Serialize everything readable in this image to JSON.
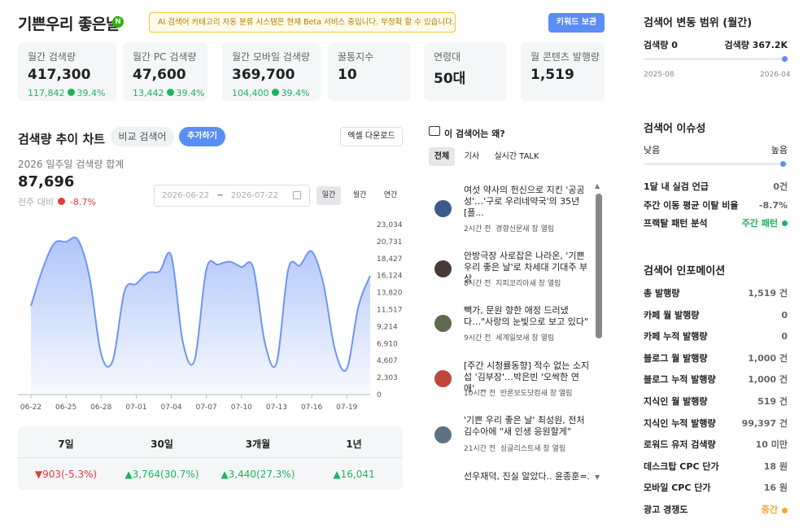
{
  "header": {
    "title": "기쁜우리 좋은날",
    "naver_badge": "N",
    "beta_notice": "AI 검색어 카테고리 자동 분류 시스템은 현재 Beta 서비스 중입니다. 부정확 할 수 있습니다.",
    "keyword_save": "키워드 보관"
  },
  "stats": [
    {
      "label": "월간 검색량",
      "value": "417,300",
      "sub_value": "117,842",
      "sub_pct": "39.4%"
    },
    {
      "label": "월간 PC 검색량",
      "value": "47,600",
      "sub_value": "13,442",
      "sub_pct": "39.4%"
    },
    {
      "label": "월간 모바일 검색량",
      "value": "369,700",
      "sub_value": "104,400",
      "sub_pct": "39.4%"
    },
    {
      "label": "꿀통지수",
      "value": "10"
    },
    {
      "label": "연령대",
      "value": "50대"
    },
    {
      "label": "월 콘텐츠 발행량",
      "value": "1,519"
    }
  ],
  "trend": {
    "title": "검색량 추이 차트",
    "compare_tab": "비교 검색어",
    "add_tab": "추가하기",
    "excel": "엑셀 다운로드",
    "subtitle": "2026 일주일 검색량 합계",
    "total": "87,696",
    "wow_label": "전주 대비",
    "wow_value": "-8.7%",
    "date_from": "2026-06-22",
    "date_sep": "~",
    "date_to": "2026-07-22",
    "periods": [
      "일간",
      "월간",
      "연간"
    ]
  },
  "chart_data": {
    "type": "area",
    "x": [
      "06-22",
      "06-23",
      "06-24",
      "06-25",
      "06-26",
      "06-27",
      "06-28",
      "06-29",
      "06-30",
      "07-01",
      "07-02",
      "07-03",
      "07-04",
      "07-05",
      "07-06",
      "07-07",
      "07-08",
      "07-09",
      "07-10",
      "07-11",
      "07-12",
      "07-13",
      "07-14",
      "07-15",
      "07-16",
      "07-17",
      "07-18",
      "07-19",
      "07-20",
      "07-21"
    ],
    "y": [
      12000,
      17000,
      20500,
      20700,
      21000,
      16000,
      5500,
      4600,
      14000,
      15000,
      16500,
      16700,
      18800,
      7000,
      4700,
      17000,
      17600,
      18000,
      17300,
      17200,
      7000,
      4300,
      17000,
      17500,
      19400,
      15000,
      6000,
      3500,
      12000,
      16100
    ],
    "x_ticks": [
      "06-22",
      "06-25",
      "06-28",
      "07-01",
      "07-04",
      "07-07",
      "07-10",
      "07-13",
      "07-16",
      "07-19"
    ],
    "y_ticks": [
      "23,034",
      "20,731",
      "18,427",
      "16,124",
      "13,820",
      "11,517",
      "9,214",
      "6,910",
      "4,607",
      "2,303",
      "0"
    ],
    "ylim": [
      0,
      23034
    ],
    "color": "#6f96f4",
    "grid": false
  },
  "summary": {
    "headers": [
      "7일",
      "30일",
      "3개월",
      "1년"
    ],
    "values": [
      "▼903(-5.3%)",
      "▲3,764(30.7%)",
      "▲3,440(27.3%)",
      "▲16,041"
    ],
    "colors": [
      "#e03b3b",
      "#1bb55c",
      "#1bb55c",
      "#1bb55c"
    ]
  },
  "news": {
    "heading": "이 검색어는 왜?",
    "tabs": [
      "전체",
      "기사",
      "실시간 TALK"
    ],
    "items": [
      {
        "title": "여섯 약사의 헌신으로 지킨 '공공성'…'구로 우리네약국'의 35년 [플...",
        "time": "2시간 전",
        "source": "경향신문새 창 열림",
        "thumb": "#3a5a8c"
      },
      {
        "title": "안방극장 사로잡은 나라온, '기쁜 우리 좋은 날'로 차세대 기대주 부상",
        "time": "8시간 전",
        "source": "지피코리아새 창 열림",
        "thumb": "#4a3a36"
      },
      {
        "title": "빽가, 문원 향한 애정 드러냈다…\"사랑의 눈빛으로 보고 있다\"",
        "time": "9시간 전",
        "source": "세계일보새 창 열림",
        "thumb": "#5d6b4f"
      },
      {
        "title": "[주간 시청률동향] 적수 없는 소지섭 '김부장'…박은빈 '오싹한 연애' ...",
        "time": "10시간 전",
        "source": "반론보도닷컴새 창 열림",
        "thumb": "#c0463a"
      },
      {
        "title": "'기쁜 우리 좋은 날' 최성원, 전처 김수아에 \"새 인생 응원할게\"",
        "time": "21시간 전",
        "source": "싱글리스트새 창 열림",
        "thumb": "#5d7280"
      },
      {
        "title": "선우재덕, 진실 알았다.. 윤종훈=교",
        "time": "",
        "source": "",
        "thumb": ""
      }
    ]
  },
  "range": {
    "title": "검색어 변동 범위 (월간)",
    "min_label": "검색량 0",
    "max_label": "검색량 367.2K",
    "from": "2025-08",
    "to": "2026-04",
    "level": 1.0
  },
  "issue": {
    "title": "검색어 이슈성",
    "low": "낮음",
    "high": "높음",
    "level": 0.95,
    "rows": [
      {
        "label": "1달 내 실검 언급",
        "value": "0건"
      },
      {
        "label": "주간 이동 평균 이탈 비율",
        "value": "-8.7%"
      },
      {
        "label": "프랙탈 패턴 분석",
        "value": "주간 패턴"
      }
    ]
  },
  "info": {
    "title": "검색어 인포메이션",
    "rows": [
      {
        "label": "총 발행량",
        "value": "1,519 건"
      },
      {
        "label": "카페 월 발행량",
        "value": "0"
      },
      {
        "label": "카페 누적 발행량",
        "value": "0"
      },
      {
        "label": "블로그 월 발행량",
        "value": "1,000 건"
      },
      {
        "label": "블로그 누적 발행량",
        "value": "1,000 건"
      },
      {
        "label": "지식인 월 발행량",
        "value": "519 건"
      },
      {
        "label": "지식인 누적 발행량",
        "value": "99,397 건"
      },
      {
        "label": "로워드 유저 검색량",
        "value": "10 미만"
      },
      {
        "label": "데스크탑 CPC 단가",
        "value": "18 원"
      },
      {
        "label": "모바일 CPC 단가",
        "value": "16 원"
      },
      {
        "label": "광고 경쟁도",
        "value": "중간"
      }
    ]
  }
}
